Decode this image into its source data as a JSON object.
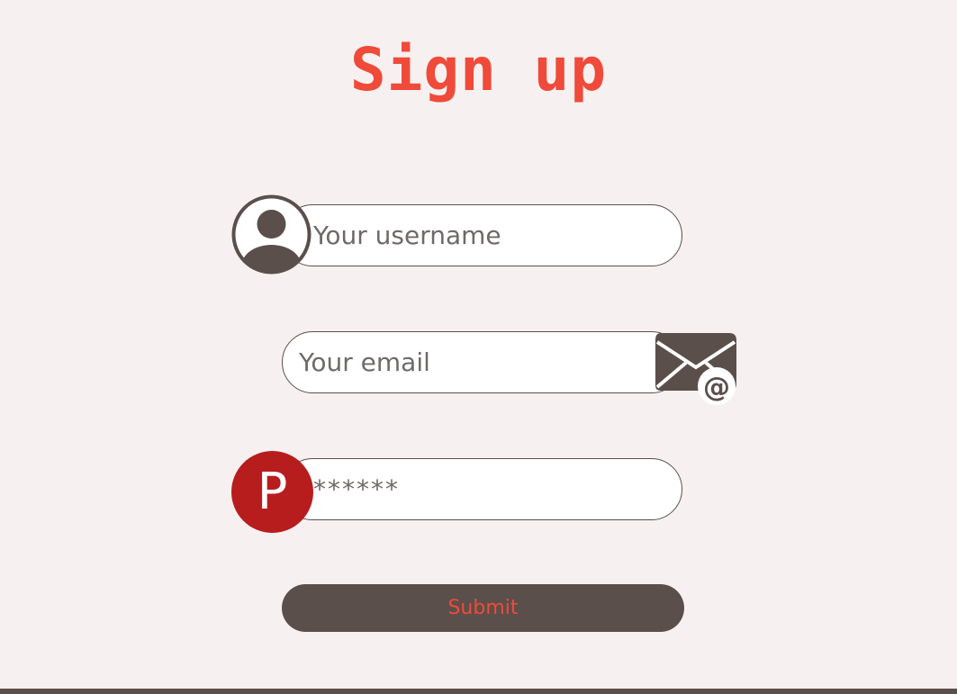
{
  "page": {
    "title": "Sign up"
  },
  "form": {
    "username": {
      "placeholder": "Your username",
      "icon": "user-avatar-icon"
    },
    "email": {
      "placeholder": "Your email",
      "icon": "envelope-at-icon"
    },
    "password": {
      "value": "******",
      "icon_letter": "P",
      "icon": "password-p-icon"
    },
    "submit_label": "Submit"
  },
  "colors": {
    "background": "#f6f1f0",
    "accent": "#f04a3a",
    "dark": "#5b4f4b",
    "password_badge": "#b81d1d"
  }
}
